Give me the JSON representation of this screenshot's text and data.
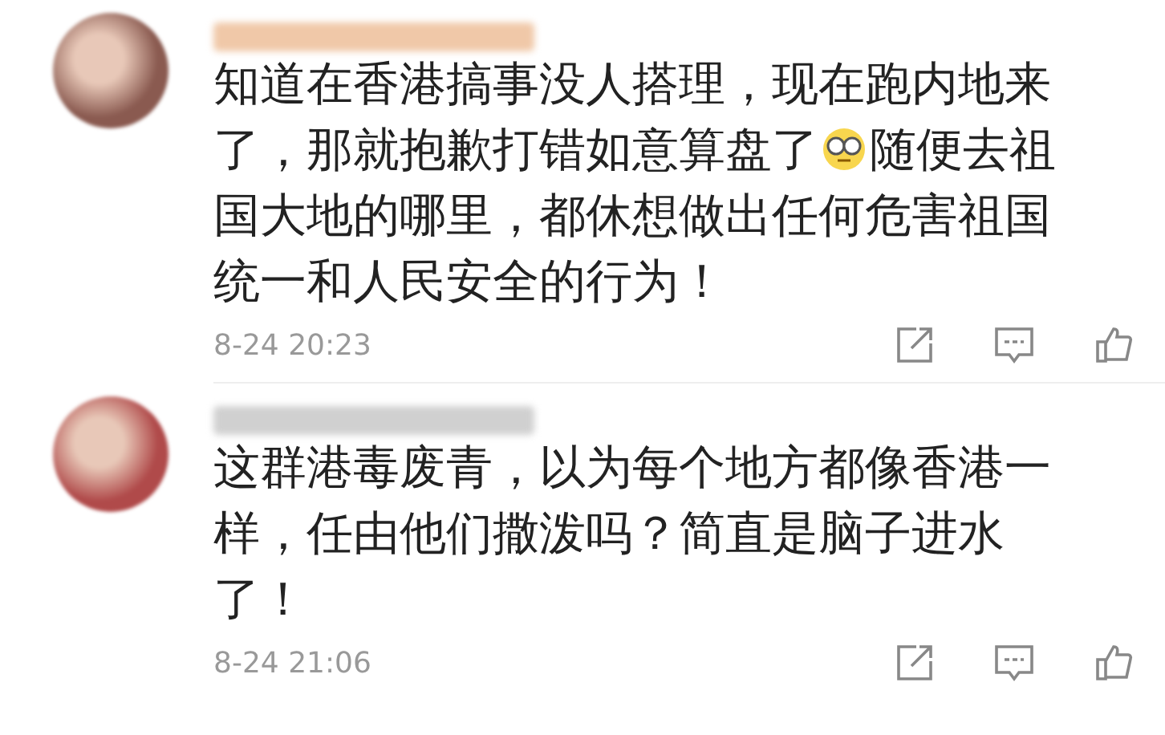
{
  "comments": [
    {
      "segments": [
        {
          "kind": "text",
          "text": "知道在香港搞事没人搭理，现在跑内地来了，那就抱歉打错如意算盘了"
        },
        {
          "kind": "emoji"
        },
        {
          "kind": "text",
          "text": "随便去祖国大地的哪里，都休想做出任何危害祖国统一和人民安全的行为！"
        }
      ],
      "time": "8-24 20:23"
    },
    {
      "segments": [
        {
          "kind": "text",
          "text": "这群港毒废青，以为每个地方都像香港一样，任由他们撒泼吗？简直是脑子进水了！"
        }
      ],
      "time": "8-24 21:06"
    }
  ]
}
